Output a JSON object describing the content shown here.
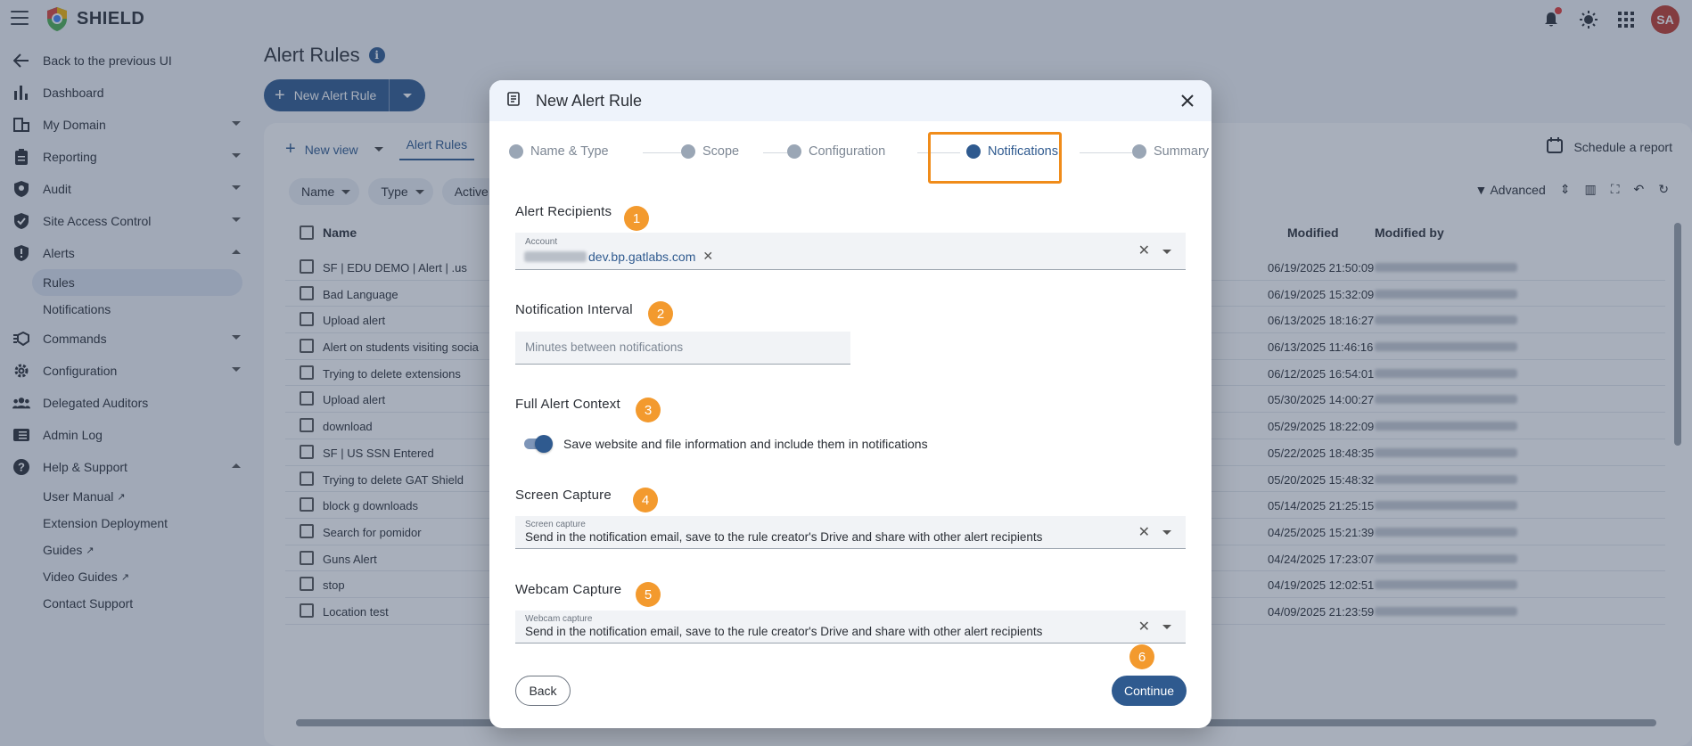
{
  "app": {
    "brand": "SHIELD",
    "avatar": "SA"
  },
  "sidebar": {
    "back": "Back to the previous UI",
    "items": [
      {
        "label": "Dashboard",
        "icon": "bar-chart-icon"
      },
      {
        "label": "My Domain",
        "icon": "building-icon"
      },
      {
        "label": "Reporting",
        "icon": "clipboard-icon"
      },
      {
        "label": "Audit",
        "icon": "audit-search-icon"
      },
      {
        "label": "Site Access Control",
        "icon": "shield-check-icon"
      },
      {
        "label": "Alerts",
        "icon": "alert-shield-icon"
      }
    ],
    "alerts_sub": [
      "Rules",
      "Notifications"
    ],
    "items2": [
      {
        "label": "Commands",
        "icon": "commands-icon"
      },
      {
        "label": "Configuration",
        "icon": "gear-icon"
      },
      {
        "label": "Delegated Auditors",
        "icon": "people-icon"
      },
      {
        "label": "Admin Log",
        "icon": "log-icon"
      },
      {
        "label": "Help & Support",
        "icon": "help-icon"
      }
    ],
    "help_sub": [
      "User Manual",
      "Extension Deployment",
      "Guides",
      "Video Guides",
      "Contact Support"
    ]
  },
  "page": {
    "title": "Alert Rules",
    "new_rule": "New Alert Rule",
    "new_view": "New view",
    "tab": "Alert Rules",
    "schedule": "Schedule a report",
    "chips": [
      "Name",
      "Type",
      "Active"
    ],
    "advanced": "Advanced",
    "columns": {
      "name": "Name",
      "modified": "Modified",
      "modified_by": "Modified by"
    },
    "rows": [
      {
        "name": "SF | EDU DEMO | Alert | .us",
        "modified": "06/19/2025 21:50:09"
      },
      {
        "name": "Bad Language",
        "modified": "06/19/2025 15:32:09"
      },
      {
        "name": "Upload alert",
        "modified": "06/13/2025 18:16:27"
      },
      {
        "name": "Alert on students visiting socia",
        "modified": "06/13/2025 11:46:16"
      },
      {
        "name": "Trying to delete extensions",
        "modified": "06/12/2025 16:54:01"
      },
      {
        "name": "Upload alert",
        "modified": "05/30/2025 14:00:27"
      },
      {
        "name": "download",
        "modified": "05/29/2025 18:22:09"
      },
      {
        "name": "SF | US SSN Entered",
        "modified": "05/22/2025 18:48:35"
      },
      {
        "name": "Trying to delete GAT Shield",
        "modified": "05/20/2025 15:48:32"
      },
      {
        "name": "block g downloads",
        "modified": "05/14/2025 21:25:15"
      },
      {
        "name": "Search for pomidor",
        "modified": "04/25/2025 15:21:39"
      },
      {
        "name": "Guns Alert",
        "modified": "04/24/2025 17:23:07"
      },
      {
        "name": "stop",
        "modified": "04/19/2025 12:02:51"
      },
      {
        "name": "Location test",
        "modified": "04/09/2025 21:23:59"
      }
    ]
  },
  "modal": {
    "title": "New Alert Rule",
    "steps": [
      "Name & Type",
      "Scope",
      "Configuration",
      "Notifications",
      "Summary"
    ],
    "active_step": "Notifications",
    "recipients": {
      "label": "Alert Recipients",
      "badge": "1",
      "field_label": "Account",
      "chip": "dev.bp.gatlabs.com"
    },
    "interval": {
      "label": "Notification Interval",
      "badge": "2",
      "placeholder": "Minutes between notifications"
    },
    "context": {
      "label": "Full Alert Context",
      "badge": "3",
      "toggle_text": "Save website and file information and include them in notifications",
      "enabled": true
    },
    "screen": {
      "label": "Screen Capture",
      "badge": "4",
      "field_label": "Screen capture",
      "value": "Send in the notification email, save to the rule creator's Drive and share with other alert recipients"
    },
    "webcam": {
      "label": "Webcam Capture",
      "badge": "5",
      "field_label": "Webcam capture",
      "value": "Send in the notification email, save to the rule creator's Drive and share with other alert recipients"
    },
    "badge6": "6",
    "back": "Back",
    "continue": "Continue"
  },
  "colors": {
    "primary": "#2f5a8f",
    "badge": "#f39a2e",
    "highlight": "#f08c1a"
  }
}
